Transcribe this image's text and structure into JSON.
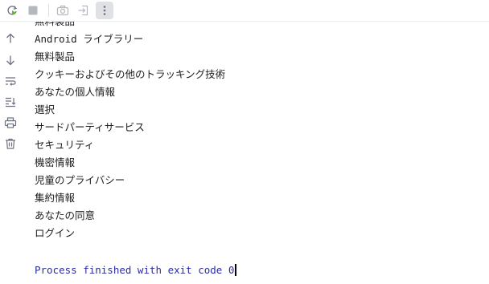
{
  "toolbar": {
    "buttons": [
      {
        "icon": "rerun-icon",
        "enabled": true
      },
      {
        "icon": "stop-icon",
        "enabled": false
      },
      {
        "icon": "camera-icon",
        "enabled": false
      },
      {
        "icon": "restore-layout-icon",
        "enabled": false
      },
      {
        "icon": "more-vertical-icon",
        "enabled": true
      }
    ]
  },
  "gutter": {
    "buttons": [
      "up-arrow-icon",
      "down-arrow-icon",
      "soft-wrap-icon",
      "scroll-to-end-icon",
      "print-icon",
      "trash-icon"
    ]
  },
  "console": {
    "partial_top_line": "無料製品",
    "lines": [
      "Android ライブラリー",
      "無料製品",
      "クッキーおよびその他のトラッキング技術",
      "あなたの個人情報",
      "選択",
      "サードパーティサービス",
      "セキュリティ",
      "機密情報",
      "児童のプライバシー",
      "集約情報",
      "あなたの同意",
      "ログイン"
    ],
    "exit_message": "Process finished with exit code 0"
  },
  "colors": {
    "exit_text": "#2b2ba3",
    "rerun_green": "#5fb832",
    "icon_gray": "#6c707e",
    "disabled_gray": "#b4b8bf"
  }
}
